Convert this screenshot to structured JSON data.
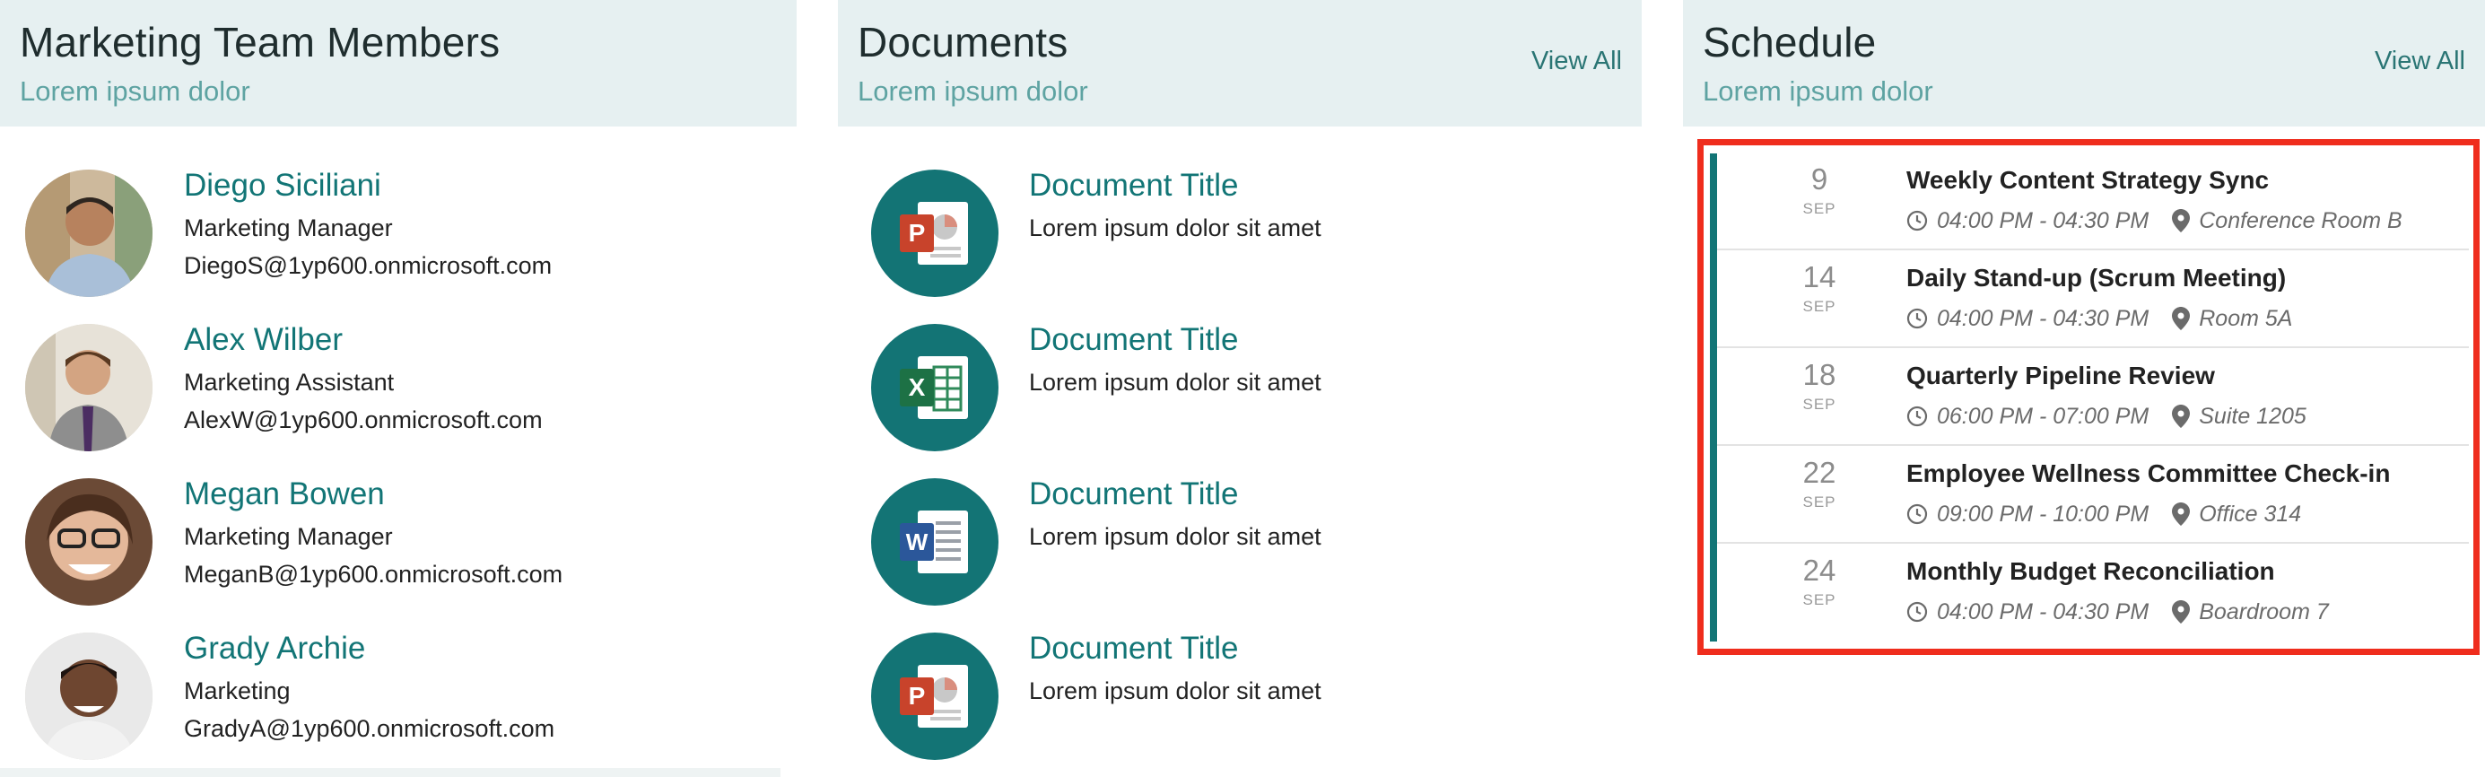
{
  "members_panel": {
    "title": "Marketing Team Members",
    "subtitle": "Lorem ipsum dolor",
    "members": [
      {
        "name": "Diego Siciliani",
        "role": "Marketing Manager",
        "email": "DiegoS@1yp600.onmicrosoft.com"
      },
      {
        "name": "Alex Wilber",
        "role": "Marketing Assistant",
        "email": "AlexW@1yp600.onmicrosoft.com"
      },
      {
        "name": "Megan Bowen",
        "role": "Marketing Manager",
        "email": "MeganB@1yp600.onmicrosoft.com"
      },
      {
        "name": "Grady Archie",
        "role": "Marketing",
        "email": "GradyA@1yp600.onmicrosoft.com"
      }
    ]
  },
  "documents_panel": {
    "title": "Documents",
    "subtitle": "Lorem ipsum dolor",
    "view_all_label": "View All",
    "documents": [
      {
        "title": "Document Title",
        "description": "Lorem ipsum dolor sit amet",
        "icon": "powerpoint-icon",
        "letter": "P"
      },
      {
        "title": "Document Title",
        "description": "Lorem ipsum dolor sit amet",
        "icon": "excel-icon",
        "letter": "X"
      },
      {
        "title": "Document Title",
        "description": "Lorem ipsum dolor sit amet",
        "icon": "word-icon",
        "letter": "W"
      },
      {
        "title": "Document Title",
        "description": "Lorem ipsum dolor sit amet",
        "icon": "powerpoint-icon",
        "letter": "P"
      }
    ]
  },
  "schedule_panel": {
    "title": "Schedule",
    "subtitle": "Lorem ipsum dolor",
    "view_all_label": "View All",
    "events": [
      {
        "day": "9",
        "month": "SEP",
        "title": "Weekly Content Strategy Sync",
        "time": "04:00 PM - 04:30 PM",
        "location": "Conference Room B"
      },
      {
        "day": "14",
        "month": "SEP",
        "title": "Daily Stand-up (Scrum Meeting)",
        "time": "04:00 PM - 04:30 PM",
        "location": "Room 5A"
      },
      {
        "day": "18",
        "month": "SEP",
        "title": "Quarterly Pipeline Review",
        "time": "06:00 PM - 07:00 PM",
        "location": "Suite 1205"
      },
      {
        "day": "22",
        "month": "SEP",
        "title": "Employee Wellness Committee Check-in",
        "time": "09:00 PM - 10:00 PM",
        "location": "Office 314"
      },
      {
        "day": "24",
        "month": "SEP",
        "title": "Monthly Budget Reconciliation",
        "time": "04:00 PM - 04:30 PM",
        "location": "Boardroom 7"
      }
    ]
  },
  "colors": {
    "accent": "#127576",
    "header_bg": "#e6f0f1",
    "subtitle": "#5ea3a2",
    "highlight_border": "#ef2d1d",
    "powerpoint": "#c8432b",
    "excel": "#1d7145",
    "word": "#2b579a"
  }
}
